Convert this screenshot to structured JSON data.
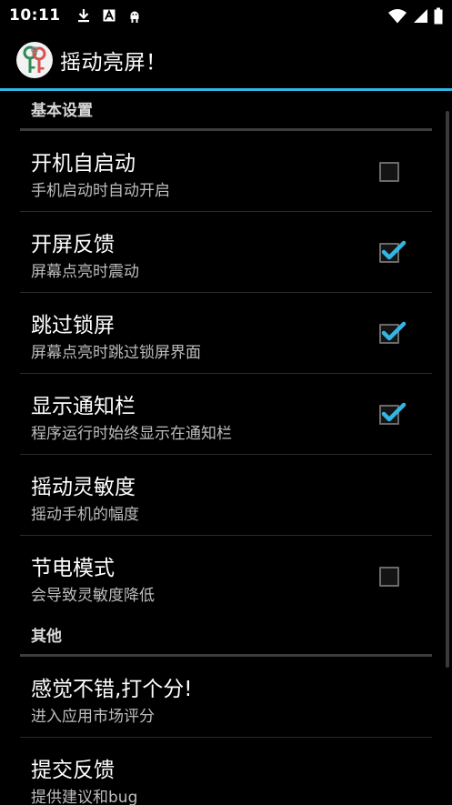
{
  "status_bar": {
    "time": "10:11",
    "left_icons": [
      "download-icon",
      "a-badge-icon",
      "android-icon"
    ],
    "right_icons": [
      "wifi-icon",
      "signal-icon",
      "battery-icon"
    ]
  },
  "app_bar": {
    "title": "摇动亮屏！",
    "icon": "keys-icon",
    "accent_color": "#33b5e5"
  },
  "sections": [
    {
      "header": "基本设置",
      "items": [
        {
          "title": "开机自启动",
          "summary": "手机启动时自动开启",
          "checkbox": true,
          "checked": false
        },
        {
          "title": "开屏反馈",
          "summary": "屏幕点亮时震动",
          "checkbox": true,
          "checked": true
        },
        {
          "title": "跳过锁屏",
          "summary": "屏幕点亮时跳过锁屏界面",
          "checkbox": true,
          "checked": true
        },
        {
          "title": "显示通知栏",
          "summary": "程序运行时始终显示在通知栏",
          "checkbox": true,
          "checked": true
        },
        {
          "title": "摇动灵敏度",
          "summary": "摇动手机的幅度",
          "checkbox": false,
          "checked": false
        },
        {
          "title": "节电模式",
          "summary": "会导致灵敏度降低",
          "checkbox": true,
          "checked": false
        }
      ]
    },
    {
      "header": "其他",
      "items": [
        {
          "title": "感觉不错,打个分!",
          "summary": "进入应用市场评分",
          "checkbox": false,
          "checked": false
        },
        {
          "title": "提交反馈",
          "summary": "提供建议和bug",
          "checkbox": false,
          "checked": false
        }
      ]
    }
  ]
}
